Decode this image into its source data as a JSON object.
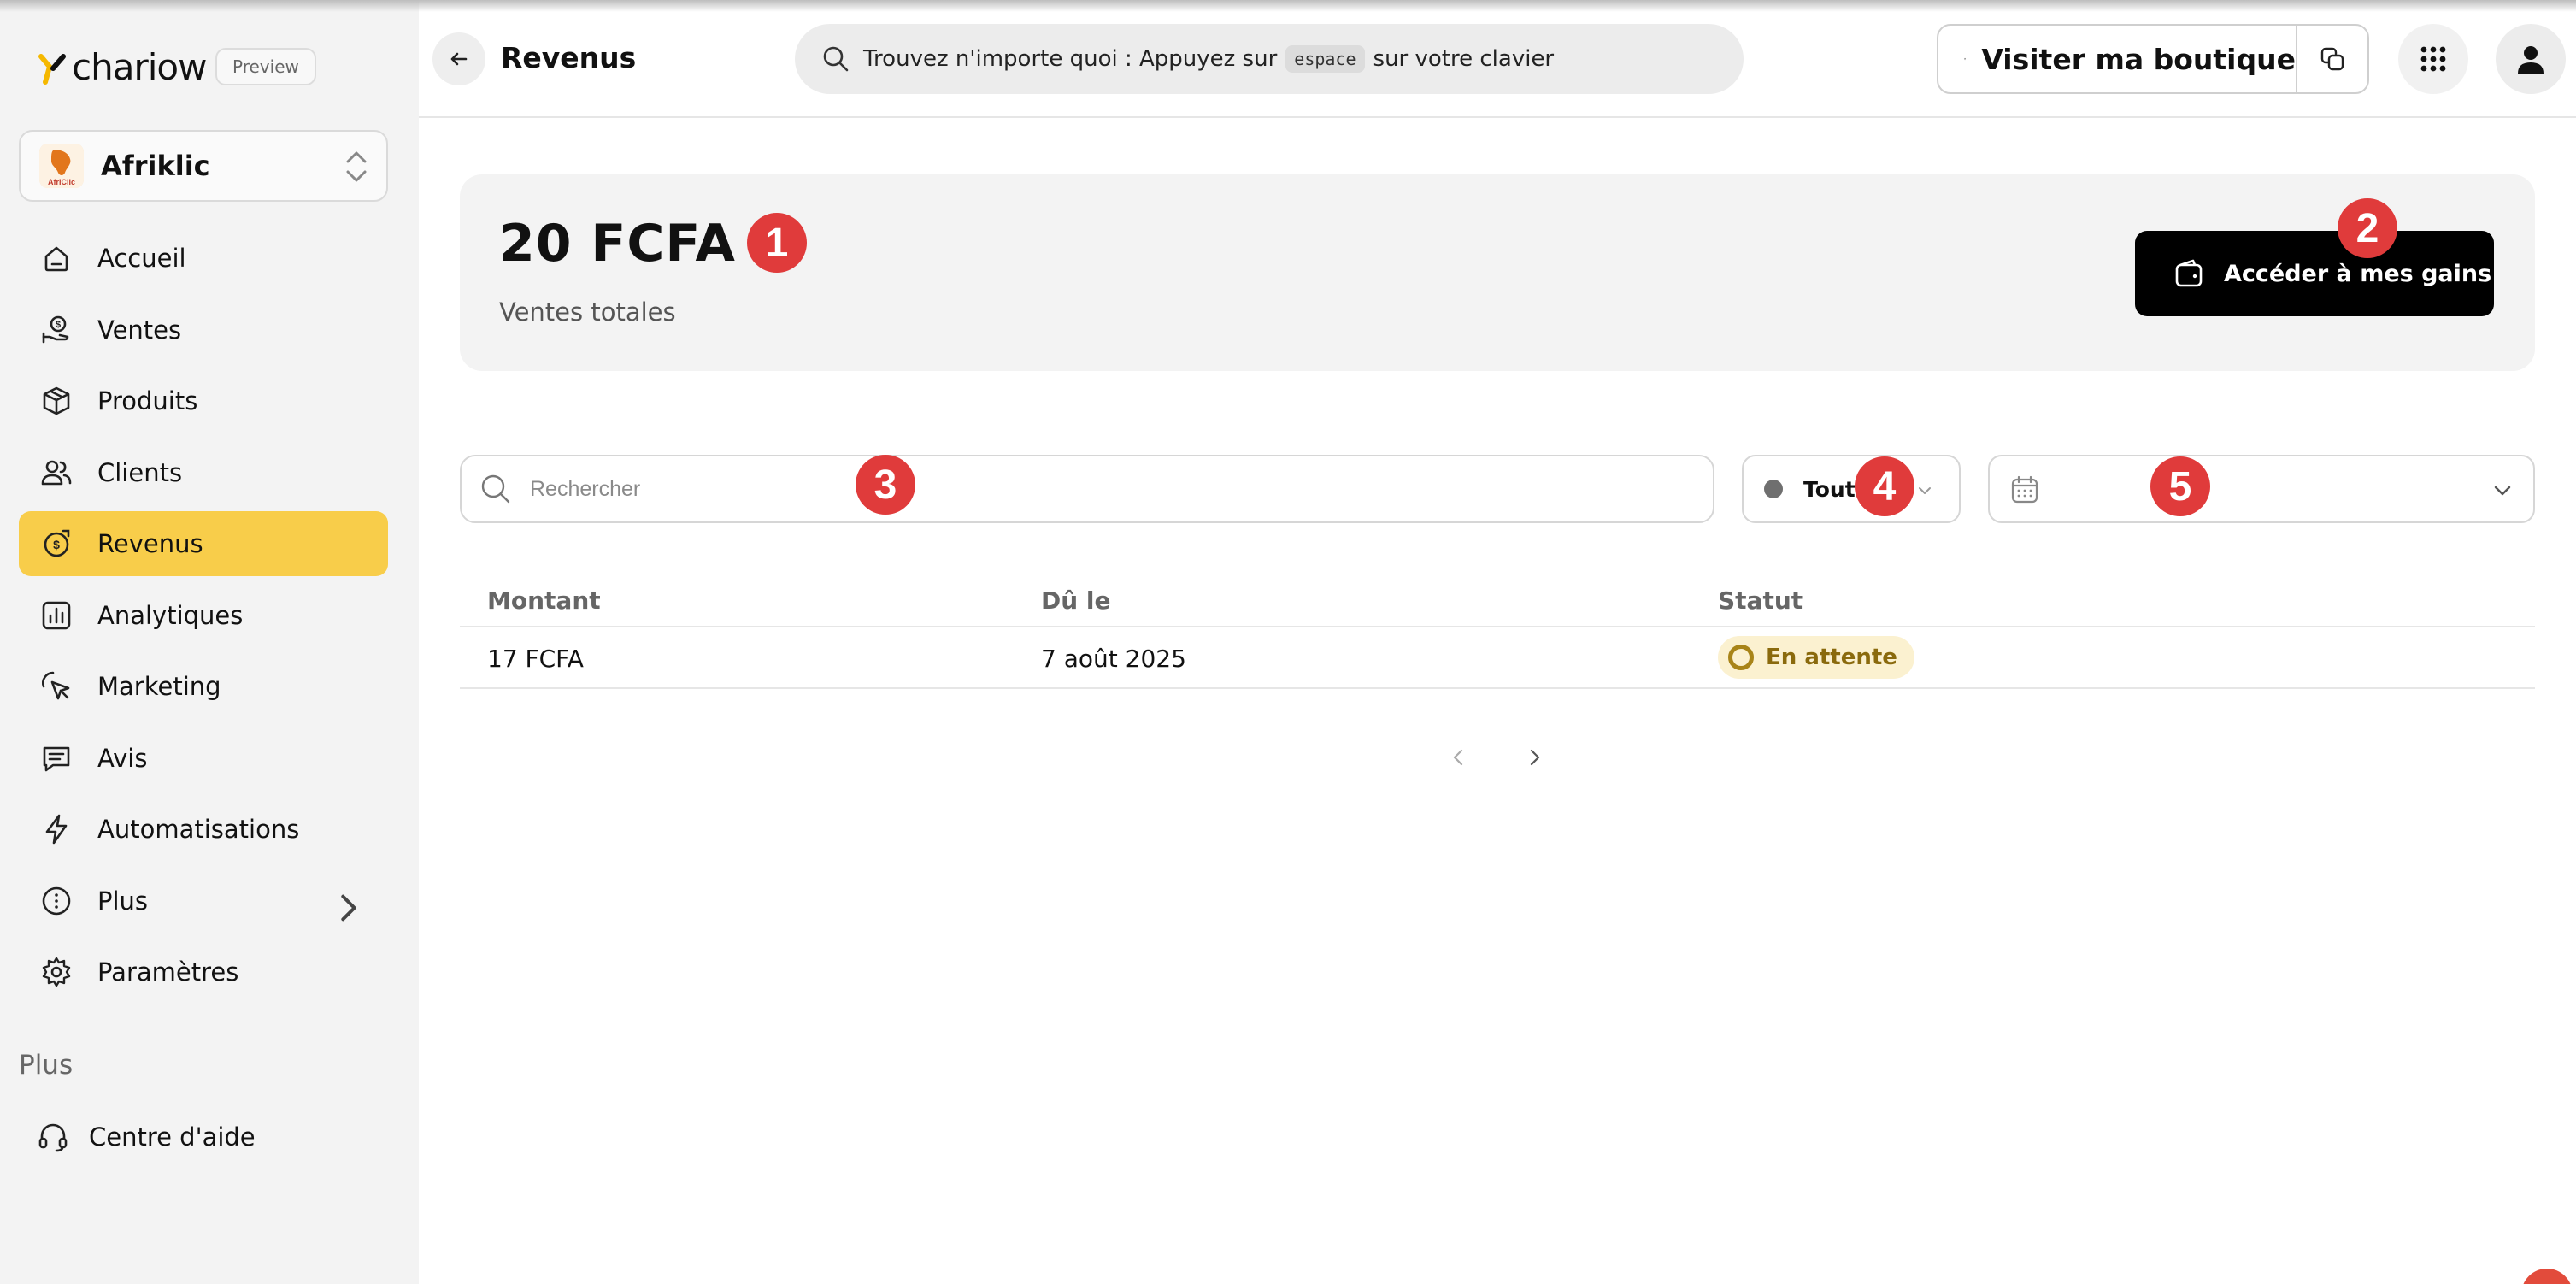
{
  "brand": {
    "name": "chariow",
    "badge": "Preview",
    "accent": "#f8cd4a",
    "marker_color": "#e03b3b"
  },
  "store": {
    "name": "Afriklic"
  },
  "sidebar": {
    "items": [
      {
        "label": "Accueil",
        "icon": "home-icon"
      },
      {
        "label": "Ventes",
        "icon": "money-hand-icon"
      },
      {
        "label": "Produits",
        "icon": "box-icon"
      },
      {
        "label": "Clients",
        "icon": "users-icon"
      },
      {
        "label": "Revenus",
        "icon": "revenue-icon",
        "active": true
      },
      {
        "label": "Analytiques",
        "icon": "chart-icon"
      },
      {
        "label": "Marketing",
        "icon": "cursor-click-icon"
      },
      {
        "label": "Avis",
        "icon": "message-icon"
      },
      {
        "label": "Automatisations",
        "icon": "lightning-icon"
      },
      {
        "label": "Plus",
        "icon": "more-circle-icon"
      },
      {
        "label": "Paramètres",
        "icon": "gear-icon"
      }
    ],
    "section_title": "Plus",
    "help_label": "Centre d'aide"
  },
  "header": {
    "title": "Revenus",
    "search_before": "Trouvez n'importe quoi : Appuyez sur",
    "search_key": "espace",
    "search_after": "sur votre clavier",
    "visit_label": "Visiter ma boutique"
  },
  "summary": {
    "total_value": "20 FCFA",
    "total_label": "Ventes totales",
    "gains_button": "Accéder à mes gains"
  },
  "filters": {
    "search_placeholder": "Rechercher",
    "status_value": "Tout"
  },
  "table": {
    "columns": [
      "Montant",
      "Dû le",
      "Statut"
    ],
    "rows": [
      {
        "amount": "17 FCFA",
        "due": "7 août 2025",
        "status": "En attente"
      }
    ]
  },
  "markers": [
    "1",
    "2",
    "3",
    "4",
    "5"
  ]
}
